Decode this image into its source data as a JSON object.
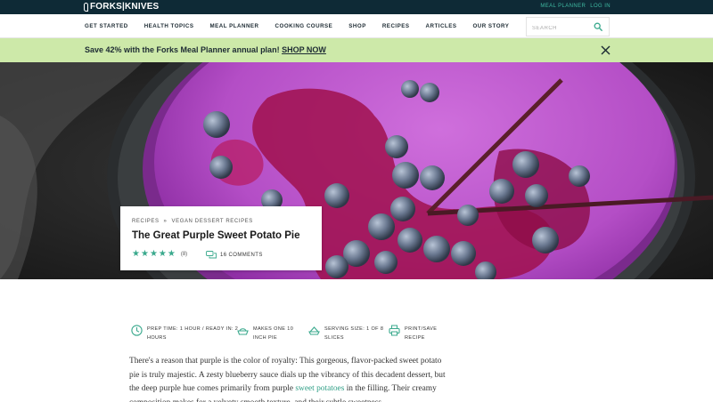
{
  "header": {
    "logo_text": "FORKS|KNIVES",
    "top_links": [
      "MEAL PLANNER",
      "LOG IN"
    ]
  },
  "nav": {
    "items": [
      "GET STARTED",
      "HEALTH TOPICS",
      "MEAL PLANNER",
      "COOKING COURSE",
      "SHOP",
      "RECIPES",
      "ARTICLES",
      "OUR STORY"
    ],
    "search_placeholder": "SEARCH",
    "search_icon": "search-icon"
  },
  "promo": {
    "text": "Save 42% with the Forks Meal Planner annual plan! ",
    "link": "SHOP NOW",
    "close_icon": "close-icon"
  },
  "recipe": {
    "breadcrumb": [
      "RECIPES",
      "VEGAN DESSERT RECIPES"
    ],
    "breadcrumb_separator": "»",
    "title": "The Great Purple Sweet Potato Pie",
    "rating": {
      "stars": 5,
      "max": 5,
      "count_label": "(8)"
    },
    "comments_label": "16 COMMENTS"
  },
  "meta": [
    {
      "icon": "clock-icon",
      "text": "PREP TIME: 1 HOUR / READY IN: 2\nHOURS"
    },
    {
      "icon": "pie-dish-icon",
      "text": "MAKES ONE 10\nINCH PIE"
    },
    {
      "icon": "serving-dish-icon",
      "text": "SERVING SIZE: 1 OF 8\nSLICES"
    },
    {
      "icon": "printer-icon",
      "text": "PRINT/SAVE\nRECIPE"
    }
  ],
  "article": {
    "intro_before": "There's a reason that purple is the color of royalty: This gorgeous, flavor-packed sweet potato pie is truly majestic. A zesty blueberry sauce dials up the vibrancy of this decadent dessert, but the deep purple hue comes primarily from purple ",
    "intro_link": "sweet potatoes",
    "intro_after": " in the filling. Their creamy composition makes for a velvety smooth texture, and their subtle sweetness"
  },
  "colors": {
    "topbar": "#0e2a36",
    "accent_teal": "#3aa98d",
    "promo_bg": "#cde9a9",
    "pie_purple": "#b94fc8"
  }
}
